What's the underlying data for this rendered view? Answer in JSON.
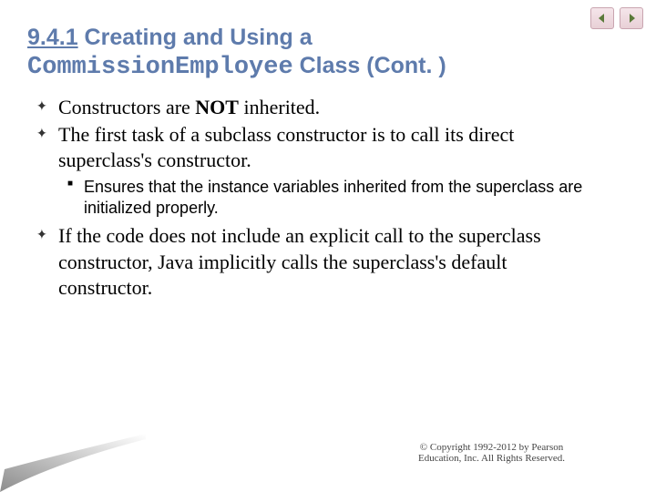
{
  "nav": {
    "prev": "prev",
    "next": "next"
  },
  "title": {
    "section": "9.4.1",
    "part1": " Creating and Using a ",
    "mono": "CommissionEmployee",
    "part2": " Class (Cont. )"
  },
  "bullets": {
    "b1a": "Constructors are ",
    "b1b": "NOT",
    "b1c": " inherited.",
    "b2": "The first task of a subclass constructor is to call its direct superclass's constructor.",
    "s1": "Ensures that the instance variables inherited from the superclass are initialized properly.",
    "b3": "If the code does not include an explicit call to the superclass constructor, Java implicitly calls the superclass's default constructor."
  },
  "copyright": {
    "l1": "© Copyright 1992-2012 by Pearson",
    "l2": "Education, Inc. All Rights Reserved."
  }
}
